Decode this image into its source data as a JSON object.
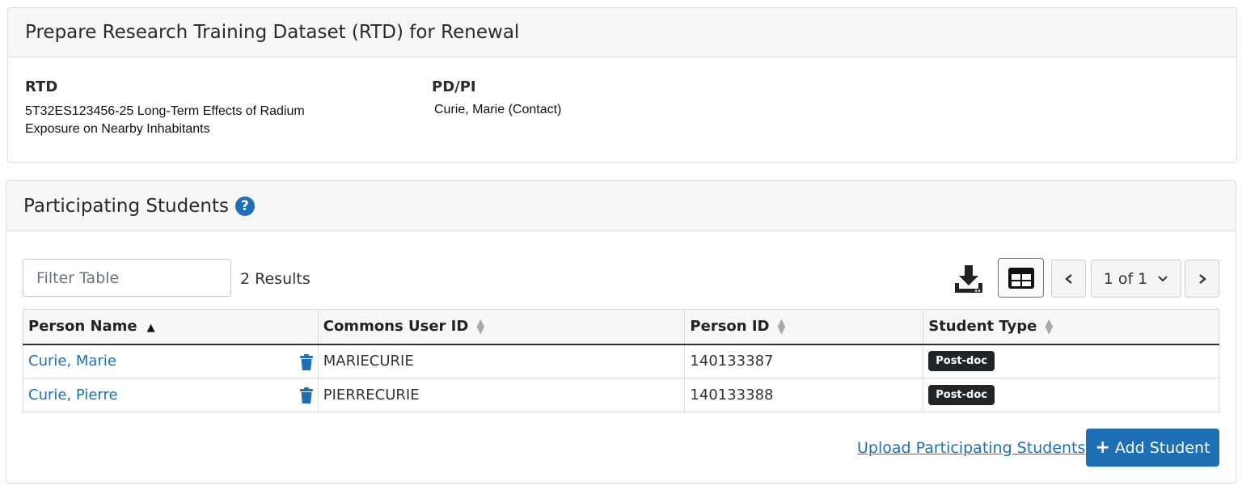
{
  "rtd_section": {
    "title": "Prepare Research Training Dataset (RTD) for Renewal",
    "rtd_label": "RTD",
    "rtd_value_line1": "5T32ES123456-25 Long-Term Effects of Radium",
    "rtd_value_line2": "Exposure on Nearby Inhabitants",
    "pdpi_label": "PD/PI",
    "pdpi_value": "Curie, Marie (Contact)"
  },
  "students_section": {
    "title": "Participating Students",
    "help_icon": "question-circle-icon",
    "filter": {
      "placeholder": "Filter Table",
      "value": ""
    },
    "results_text": "2 Results",
    "pagination": {
      "current": "1 of 1"
    },
    "columns": [
      "Person Name",
      "Commons User ID",
      "Person ID",
      "Student Type"
    ],
    "rows": [
      {
        "name": "Curie, Marie",
        "commons_id": "MARIECURIE",
        "person_id": "140133387",
        "student_type": "Post-doc"
      },
      {
        "name": "Curie, Pierre",
        "commons_id": "PIERRECURIE",
        "person_id": "140133388",
        "student_type": "Post-doc"
      }
    ],
    "upload_link": "Upload Participating Students",
    "add_button": "Add Student"
  },
  "colors": {
    "primary": "#1f6fb5",
    "badge": "#212529",
    "header_bg": "#f7f7f7"
  }
}
